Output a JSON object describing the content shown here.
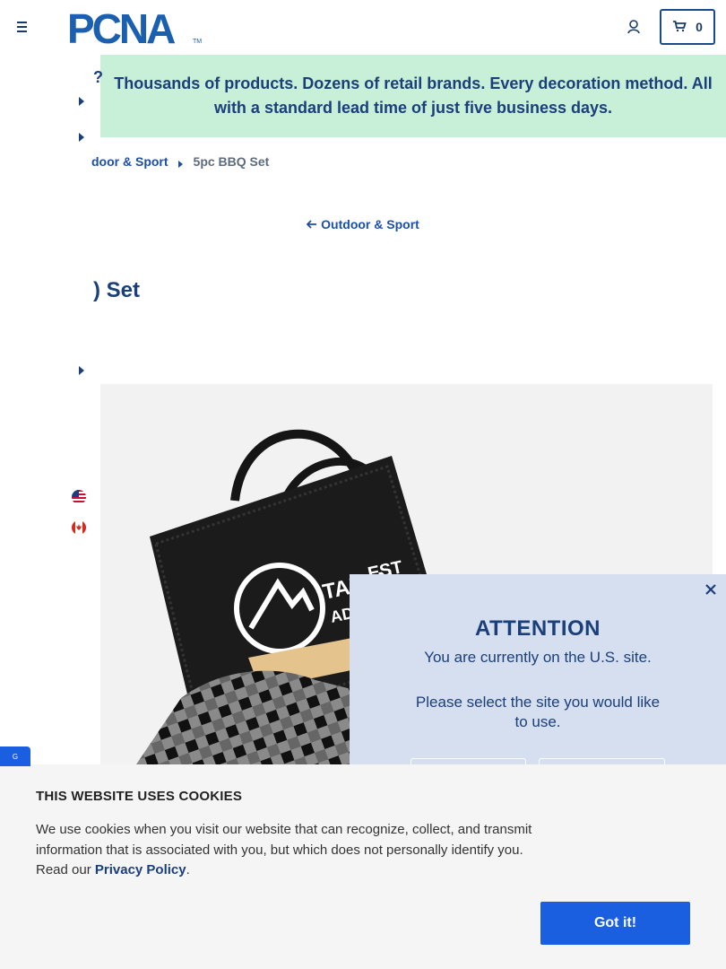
{
  "header": {
    "logo_text": "PCNA",
    "logo_mark": "TM",
    "cart_count": "0"
  },
  "banner": {
    "glyph": "?",
    "text": "Thousands of products. Dozens of retail brands. Every decoration method. All with a standard lead time of just five business days."
  },
  "breadcrumb": {
    "parent": "door & Sport",
    "current": "5pc BBQ Set"
  },
  "back_link": "Outdoor & Sport",
  "product": {
    "title": ") Set",
    "image_logo_text": "TALON",
    "image_logo_text2": "ADVEN",
    "image_logo_text3": "EST"
  },
  "attention": {
    "title": "ATTENTION",
    "line1": "You are currently on the U.S. site.",
    "line2": "Please select the site you would like to use."
  },
  "cookie": {
    "title": "THIS WEBSITE USES COOKIES",
    "body": "We use cookies when you visit our website that can recognize, collect, and transmit information that is associated with you, but which does not personally identify you. Read our ",
    "link": "Privacy Policy",
    "period": ".",
    "button": "Got it!"
  },
  "side_tab": "G",
  "colors": {
    "brand_navy": "#1b3f7a",
    "link_blue": "#1b4fa8",
    "banner_green": "#c8efd8",
    "modal_bg": "#d5dff0",
    "button_blue": "#1a5fe0"
  }
}
